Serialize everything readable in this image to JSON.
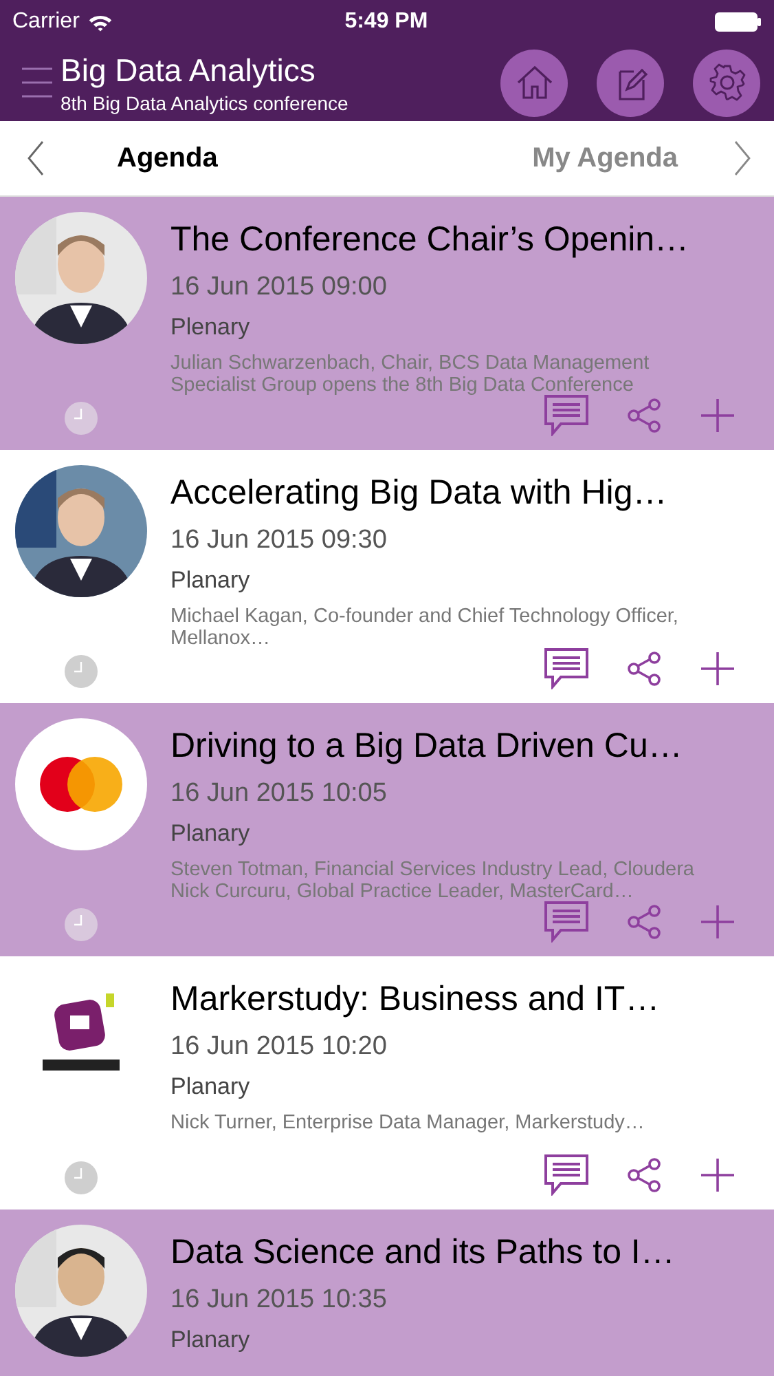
{
  "status_bar": {
    "carrier": "Carrier",
    "time": "5:49 PM"
  },
  "header": {
    "title": "Big Data Analytics",
    "subtitle": "8th Big Data Analytics conference"
  },
  "tabs": [
    {
      "label": "Agenda",
      "selected": true
    },
    {
      "label": "My Agenda",
      "selected": false
    }
  ],
  "sessions": [
    {
      "title": "The Conference Chair’s Openin…",
      "time": "16 Jun 2015 09:00",
      "type": "Plenary",
      "description": "Julian Schwarzenbach, Chair, BCS Data Management Specialist Group opens the 8th Big Data Conference"
    },
    {
      "title": "Accelerating Big Data with Hig…",
      "time": "16 Jun 2015 09:30",
      "type": "Planary",
      "description": "Michael Kagan, Co-founder and Chief Technology Officer, Mellanox…"
    },
    {
      "title": "Driving to a Big Data Driven Cu…",
      "time": "16 Jun 2015 10:05",
      "type": "Planary",
      "description": "Steven Totman, Financial Services Industry Lead, Cloudera Nick Curcuru, Global Practice Leader, MasterCard…"
    },
    {
      "title": "Markerstudy: Business and IT…",
      "time": "16 Jun 2015 10:20",
      "type": "Planary",
      "description": "Nick Turner, Enterprise Data Manager, Markerstudy…"
    },
    {
      "title": "Data Science and its Paths to I…",
      "time": "16 Jun 2015 10:35",
      "type": "Planary"
    }
  ]
}
